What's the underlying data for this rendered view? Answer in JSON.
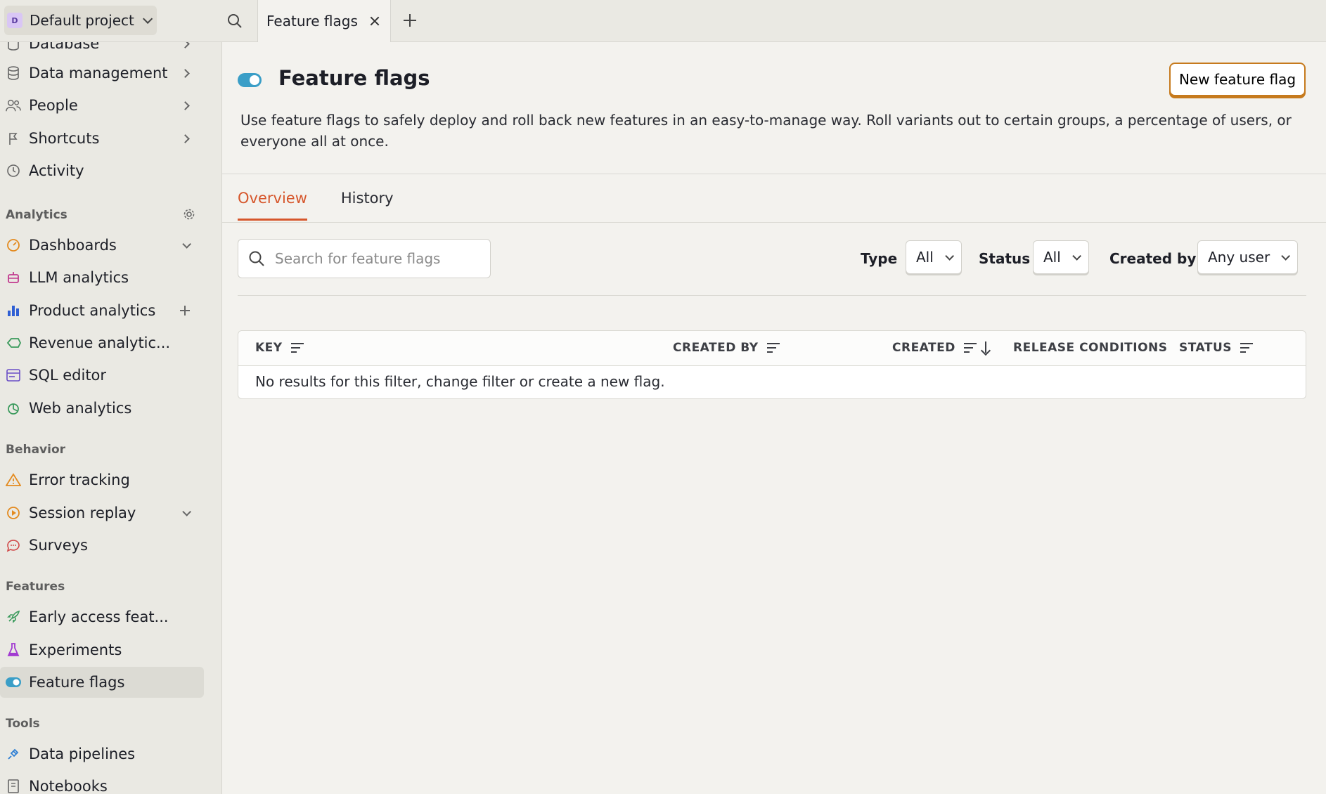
{
  "topbar": {
    "project_badge": "D",
    "project_name": "Default project",
    "tab_label": "Feature flags"
  },
  "sidebar": {
    "items_top": [
      {
        "label": "Database"
      },
      {
        "label": "Data management"
      },
      {
        "label": "People"
      },
      {
        "label": "Shortcuts"
      },
      {
        "label": "Activity"
      }
    ],
    "analytics_heading": "Analytics",
    "analytics_items": [
      {
        "label": "Dashboards"
      },
      {
        "label": "LLM analytics"
      },
      {
        "label": "Product analytics"
      },
      {
        "label": "Revenue analytic..."
      },
      {
        "label": "SQL editor"
      },
      {
        "label": "Web analytics"
      }
    ],
    "behavior_heading": "Behavior",
    "behavior_items": [
      {
        "label": "Error tracking"
      },
      {
        "label": "Session replay"
      },
      {
        "label": "Surveys"
      }
    ],
    "features_heading": "Features",
    "features_items": [
      {
        "label": "Early access feat..."
      },
      {
        "label": "Experiments"
      },
      {
        "label": "Feature flags"
      }
    ],
    "tools_heading": "Tools",
    "tools_items": [
      {
        "label": "Data pipelines"
      },
      {
        "label": "Notebooks"
      }
    ]
  },
  "page": {
    "title": "Feature flags",
    "new_button": "New feature flag",
    "description": "Use feature flags to safely deploy and roll back new features in an easy-to-manage way. Roll variants out to certain groups, a percentage of users, or everyone all at once.",
    "tabs": [
      "Overview",
      "History"
    ],
    "search_placeholder": "Search for feature flags",
    "filters": {
      "type_label": "Type",
      "type_value": "All",
      "status_label": "Status",
      "status_value": "All",
      "created_by_label": "Created by",
      "created_by_value": "Any user"
    },
    "table": {
      "columns": [
        "KEY",
        "CREATED BY",
        "CREATED",
        "RELEASE CONDITIONS",
        "STATUS"
      ],
      "empty_message": "No results for this filter, change filter or create a new flag."
    }
  },
  "colors": {
    "accent": "#d6562b",
    "button_border": "#c67a1d",
    "toggle": "#3a9ec7"
  }
}
